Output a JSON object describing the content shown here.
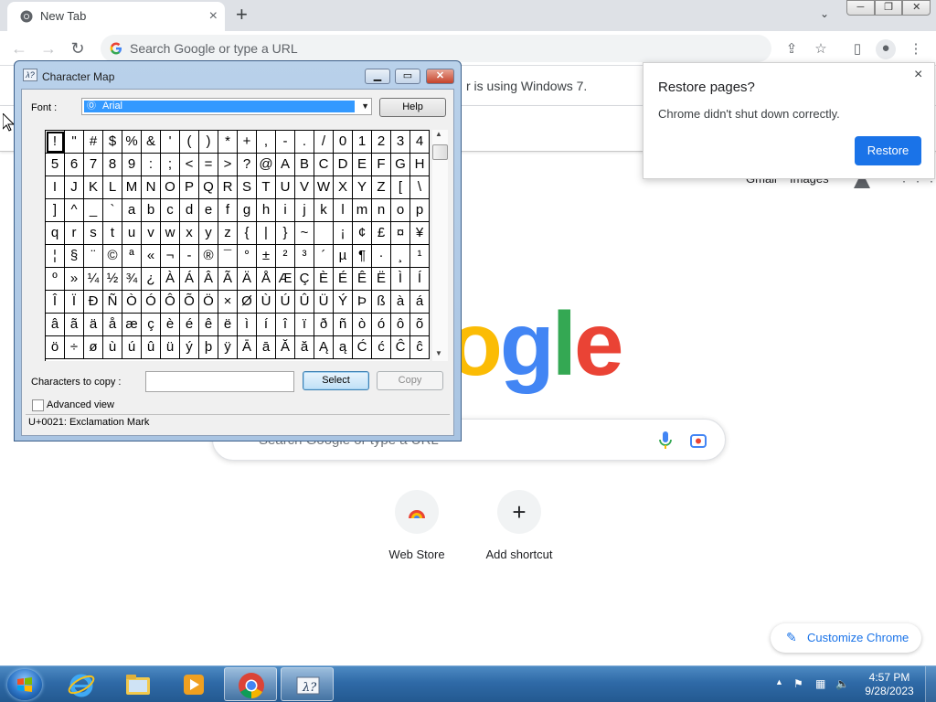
{
  "browser": {
    "tab_title": "New Tab",
    "tab_close": "×",
    "new_tab": "+",
    "omnibox_placeholder": "Search Google or type a URL",
    "infobar_text": "r is using Windows 7."
  },
  "restore": {
    "title": "Restore pages?",
    "message": "Chrome didn't shut down correctly.",
    "button": "Restore",
    "close": "×"
  },
  "ntp": {
    "gmail": "Gmail",
    "images": "Images",
    "logo": "ogle",
    "search_placeholder": "Search Google or type a URL",
    "shortcuts": [
      {
        "label": "Web Store"
      },
      {
        "label": "Add shortcut",
        "glyph": "+"
      }
    ],
    "customize": "Customize Chrome",
    "customize_icon": "pencil-icon"
  },
  "charmap": {
    "title": "Character Map",
    "font_label": "Font :",
    "font_value": "Arial",
    "help": "Help",
    "characters": [
      "!",
      "\"",
      "#",
      "$",
      "%",
      "&",
      "'",
      "(",
      ")",
      "*",
      "+",
      ",",
      "-",
      ".",
      "/",
      "0",
      "1",
      "2",
      "3",
      "4",
      "5",
      "6",
      "7",
      "8",
      "9",
      ":",
      ";",
      "<",
      "=",
      ">",
      "?",
      "@",
      "A",
      "B",
      "C",
      "D",
      "E",
      "F",
      "G",
      "H",
      "I",
      "J",
      "K",
      "L",
      "M",
      "N",
      "O",
      "P",
      "Q",
      "R",
      "S",
      "T",
      "U",
      "V",
      "W",
      "X",
      "Y",
      "Z",
      "[",
      "\\",
      "]",
      "^",
      "_",
      "`",
      "a",
      "b",
      "c",
      "d",
      "e",
      "f",
      "g",
      "h",
      "i",
      "j",
      "k",
      "l",
      "m",
      "n",
      "o",
      "p",
      "q",
      "r",
      "s",
      "t",
      "u",
      "v",
      "w",
      "x",
      "y",
      "z",
      "{",
      "|",
      "}",
      "~",
      " ",
      "¡",
      "¢",
      "£",
      "¤",
      "¥",
      "¦",
      "§",
      "¨",
      "©",
      "ª",
      "«",
      "¬",
      "-",
      "®",
      "¯",
      "°",
      "±",
      "²",
      "³",
      "´",
      "µ",
      "¶",
      "·",
      "¸",
      "¹",
      "º",
      "»",
      "¼",
      "½",
      "¾",
      "¿",
      "À",
      "Á",
      "Â",
      "Ã",
      "Ä",
      "Å",
      "Æ",
      "Ç",
      "È",
      "É",
      "Ê",
      "Ë",
      "Ì",
      "Í",
      "Î",
      "Ï",
      "Ð",
      "Ñ",
      "Ò",
      "Ó",
      "Ô",
      "Õ",
      "Ö",
      "×",
      "Ø",
      "Ù",
      "Ú",
      "Û",
      "Ü",
      "Ý",
      "Þ",
      "ß",
      "à",
      "á",
      "â",
      "ã",
      "ä",
      "å",
      "æ",
      "ç",
      "è",
      "é",
      "ê",
      "ë",
      "ì",
      "í",
      "î",
      "ï",
      "ð",
      "ñ",
      "ò",
      "ó",
      "ô",
      "õ",
      "ö",
      "÷",
      "ø",
      "ù",
      "ú",
      "û",
      "ü",
      "ý",
      "þ",
      "ÿ",
      "Ā",
      "ā",
      "Ă",
      "ă",
      "Ą",
      "ą",
      "Ć",
      "ć",
      "Ĉ",
      "ĉ"
    ],
    "copy_label": "Characters to copy :",
    "copy_value": "",
    "select": "Select",
    "copy": "Copy",
    "advanced": "Advanced view",
    "status": "U+0021: Exclamation Mark"
  },
  "taskbar": {
    "time": "4:57 PM",
    "date": "9/28/2023",
    "accent": "#2f6aa7"
  },
  "colors": {
    "chrome_blue": "#1a73e8",
    "google_blue": "#4285f4",
    "google_red": "#ea4335",
    "google_yellow": "#fbbc05",
    "google_green": "#34a853"
  }
}
